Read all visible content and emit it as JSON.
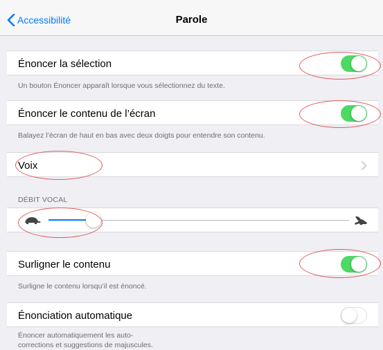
{
  "nav": {
    "back_label": "Accessibilité",
    "title": "Parole"
  },
  "speak_selection": {
    "label": "Énoncer la sélection",
    "on": true,
    "footer": "Un bouton Énoncer apparaît lorsque vous sélectionnez du texte."
  },
  "speak_screen": {
    "label": "Énoncer le contenu de l’écran",
    "on": true,
    "footer": "Balayez l’écran de haut en bas avec deux doigts pour entendre son contenu."
  },
  "voices": {
    "label": "Voix"
  },
  "speaking_rate": {
    "header": "DÉBIT VOCAL",
    "slow_icon": "turtle-icon",
    "fast_icon": "hare-icon",
    "value_fraction": 0.15
  },
  "highlight": {
    "label": "Surligner le contenu",
    "on": true,
    "footer": "Surligne le contenu lorsqu’il est énoncé."
  },
  "auto_speak": {
    "label": "Énonciation automatique",
    "on": false,
    "footer_line1": "Énoncer automatiquement les auto-",
    "footer_line2": "corrections et suggestions de majuscules."
  },
  "colors": {
    "accent": "#007aff",
    "switch_on": "#4cd964",
    "annotation": "#e05a5a",
    "background": "#efeff4"
  }
}
